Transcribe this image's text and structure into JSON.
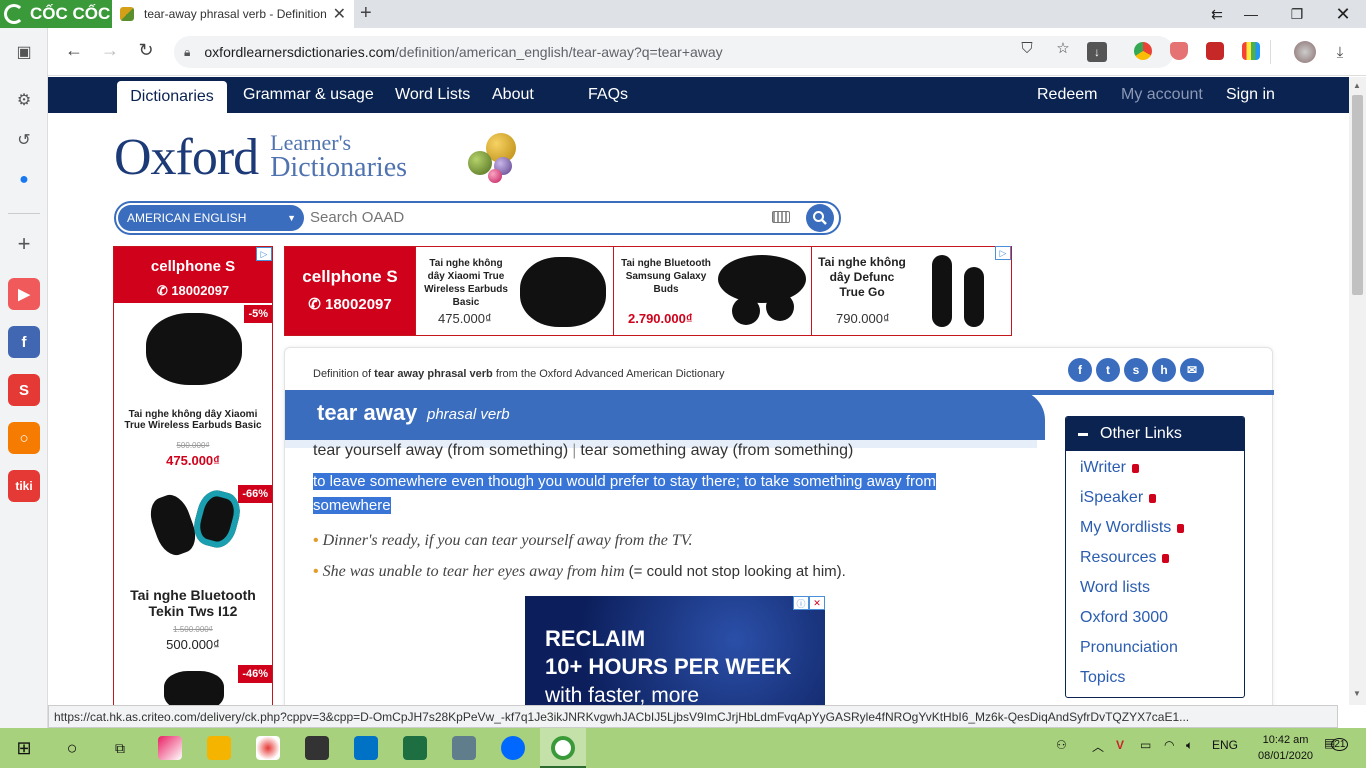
{
  "browser": {
    "brand": "CỐC CỐC",
    "tab_title": "tear-away phrasal verb - Definition",
    "url_domain": "oxfordlearnersdictionaries.com",
    "url_path": "/definition/american_english/tear-away?q=tear+away",
    "status_url": "https://cat.hk.as.criteo.com/delivery/ck.php?cppv=3&cpp=D-OmCpJH7s28KpPeVw_-kf7q1Je3ikJNRKvgwhJACbIJ5LjbsV9ImCJrjHbLdmFvqApYyGASRyle4fNROgYvKtHbI6_Mz6k-QesDiqAndSyfrDvTQZYX7caE1..."
  },
  "nav": {
    "active": "Dictionaries",
    "items": [
      "Grammar & usage",
      "Word Lists",
      "About",
      "FAQs"
    ],
    "right": [
      "Redeem",
      "My account",
      "Sign in"
    ]
  },
  "logo": {
    "oxford": "Oxford",
    "line1": "Learner's",
    "line2": "Dictionaries"
  },
  "search": {
    "dictionary": "AMERICAN ENGLISH",
    "placeholder": "Search OAAD"
  },
  "ads": {
    "cellphone_brand": "cellphone S",
    "hotline": "✆ 18002097",
    "left": [
      {
        "discount": "-5%",
        "name": "Tai nghe không dây Xiaomi True Wireless Earbuds Basic",
        "old_price": "500.000₫",
        "price": "475.000₫"
      },
      {
        "discount": "-66%",
        "name": "Tai nghe Bluetooth Tekin Tws I12",
        "old_price": "1.500.000₫",
        "price": "500.000₫"
      },
      {
        "discount": "-46%"
      }
    ],
    "top": [
      {
        "name": "Tai nghe không dây Xiaomi True Wireless Earbuds Basic",
        "price": "475.000₫"
      },
      {
        "name": "Tai nghe Bluetooth Samsung Galaxy Buds",
        "price": "2.790.000₫"
      },
      {
        "name": "Tai nghe không dây Defunc True Go",
        "price": "790.000₫"
      }
    ],
    "reclaim_line1": "RECLAIM",
    "reclaim_line2": "10+ HOURS PER WEEK",
    "reclaim_line3": "with faster, more"
  },
  "entry": {
    "definition_of_prefix": "Definition of ",
    "definition_of_term": "tear away phrasal verb",
    "definition_of_suffix": " from the Oxford Advanced American Dictionary",
    "headword": "tear away",
    "pos": "phrasal verb",
    "idiom1": "tear yourself away (from something)",
    "idiom_sep": "|",
    "idiom2": "tear something away (from something)",
    "definition": "to leave somewhere even though you would prefer to stay there; to take something away from somewhere",
    "example1": "Dinner's ready, if you can tear yourself away from the TV.",
    "example2": "She was unable to tear her eyes away from him",
    "example2_gloss": "(= could not stop looking at him)."
  },
  "other_links": {
    "title": "Other Links",
    "items": [
      "iWriter",
      "iSpeaker",
      "My Wordlists",
      "Resources",
      "Word lists",
      "Oxford 3000",
      "Pronunciation",
      "Topics"
    ]
  },
  "taskbar": {
    "lang": "ENG",
    "time": "10:42 am",
    "date": "08/01/2020",
    "notifications": "21"
  },
  "colors": {
    "oxford_navy": "#0a2351",
    "oxford_blue": "#3a6dbd",
    "taskbar": "#a7d17d",
    "highlight": "#3875d7"
  }
}
